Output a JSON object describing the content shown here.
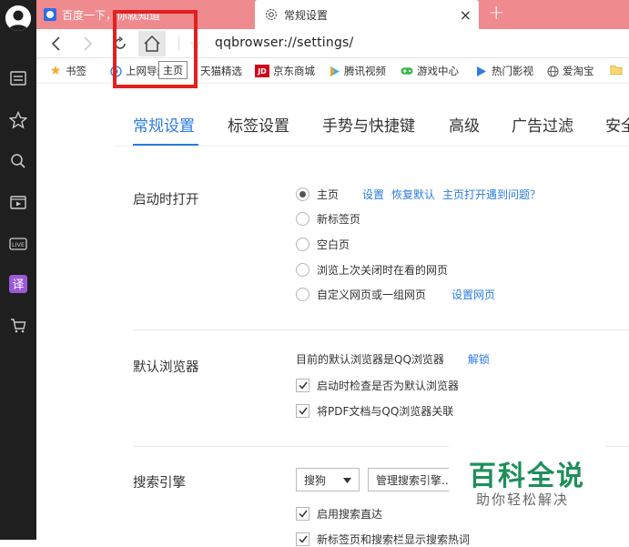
{
  "tabs": [
    {
      "title": "百度一下，你就知道"
    },
    {
      "title": "常规设置",
      "close": "×"
    }
  ],
  "new_tab": "+",
  "address": "qqbrowser://settings/",
  "tooltip": "主页",
  "bookmarks": [
    {
      "label": "书签",
      "icon": "star-icon"
    },
    {
      "label": "上网导航",
      "icon": "globe-icon"
    },
    {
      "label": "天猫精选",
      "icon": "tmall-icon"
    },
    {
      "label": "京东商城",
      "icon": "jd-icon",
      "badge": "JD"
    },
    {
      "label": "腾讯视频",
      "icon": "video-icon"
    },
    {
      "label": "游戏中心",
      "icon": "gamepad-icon"
    },
    {
      "label": "热门影视",
      "icon": "play-icon"
    },
    {
      "label": "爱淘宝",
      "icon": "globe-icon"
    }
  ],
  "settings_tabs": [
    "常规设置",
    "标签设置",
    "手势与快捷键",
    "高级",
    "广告过滤",
    "安全"
  ],
  "startup": {
    "label": "启动时打开",
    "options": [
      "主页",
      "新标签页",
      "空白页",
      "浏览上次关闭时在看的网页",
      "自定义网页或一组网页"
    ],
    "home_links": [
      "设置",
      "恢复默认",
      "主页打开遇到问题？"
    ],
    "custom_link": "设置网页"
  },
  "default_browser": {
    "label": "默认浏览器",
    "status": "目前的默认浏览器是QQ浏览器",
    "unlock": "解锁",
    "options": [
      "启动时检查是否为默认浏览器",
      "将PDF文档与QQ浏览器关联"
    ]
  },
  "search": {
    "label": "搜索引擎",
    "engine": "搜狗",
    "manage": "管理搜索引擎...",
    "options": [
      "启用搜索直达",
      "新标签页和搜索栏显示搜索热词"
    ]
  },
  "watermark": {
    "title": "百科全说",
    "subtitle": "助你轻松解决"
  },
  "colors": {
    "accent": "#2b7ce0",
    "tabstrip": "#ef8a8f",
    "sidebar": "#1f1f1f",
    "highlight": "#e2201f"
  }
}
